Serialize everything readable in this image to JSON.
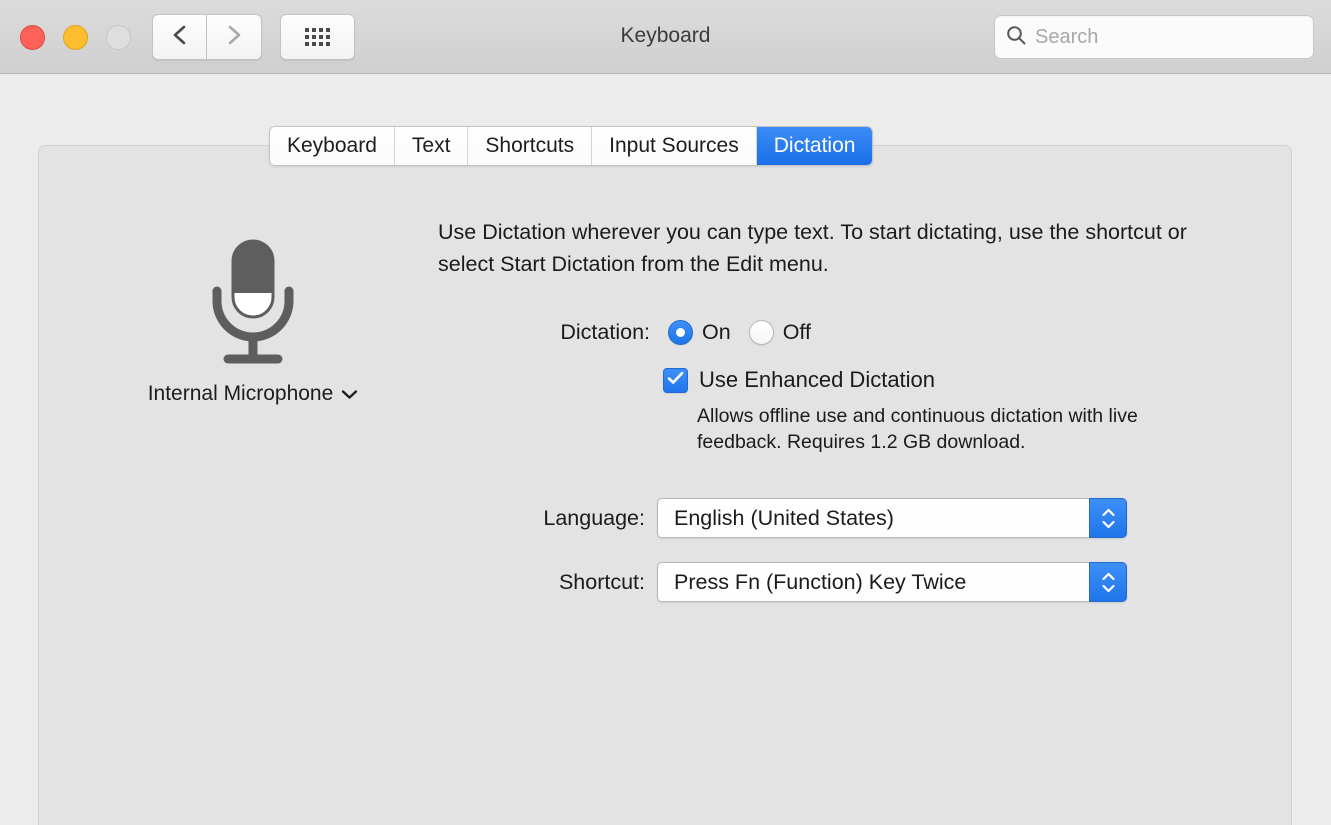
{
  "window": {
    "title": "Keyboard",
    "traffic_lights": [
      {
        "name": "close",
        "color": "#fd6158"
      },
      {
        "name": "minimize",
        "color": "#fdbd2e"
      },
      {
        "name": "zoom",
        "color": "#dedede"
      }
    ],
    "nav": {
      "back_icon": "chevron-left-icon",
      "forward_icon": "chevron-right-icon"
    },
    "grid_button_icon": "grid-dots-icon"
  },
  "search": {
    "placeholder": "Search",
    "value": "",
    "icon": "search-icon"
  },
  "tabs": [
    {
      "label": "Keyboard",
      "selected": false
    },
    {
      "label": "Text",
      "selected": false
    },
    {
      "label": "Shortcuts",
      "selected": false
    },
    {
      "label": "Input Sources",
      "selected": false
    },
    {
      "label": "Dictation",
      "selected": true
    }
  ],
  "microphone": {
    "icon": "microphone-icon",
    "caption": "Internal Microphone",
    "chevron_icon": "chevron-down-icon"
  },
  "description": "Use Dictation wherever you can type text. To start dictating, use the shortcut or select Start Dictation from the Edit menu.",
  "dictation": {
    "label": "Dictation:",
    "options": [
      {
        "label": "On",
        "selected": true
      },
      {
        "label": "Off",
        "selected": false
      }
    ]
  },
  "enhanced": {
    "label": "Use Enhanced Dictation",
    "checked": true,
    "check_icon": "checkmark-icon",
    "note": "Allows offline use and continuous dictation with live feedback. Requires 1.2 GB download."
  },
  "language": {
    "label": "Language:",
    "value": "English (United States)",
    "stepper_icon": "stepper-updown-icon"
  },
  "shortcut": {
    "label": "Shortcut:",
    "value": "Press Fn (Function) Key Twice",
    "stepper_icon": "stepper-updown-icon"
  },
  "colors": {
    "accent_blue": "#1f75ea",
    "window_bg": "#ececec",
    "panel_bg": "#e3e3e3"
  }
}
